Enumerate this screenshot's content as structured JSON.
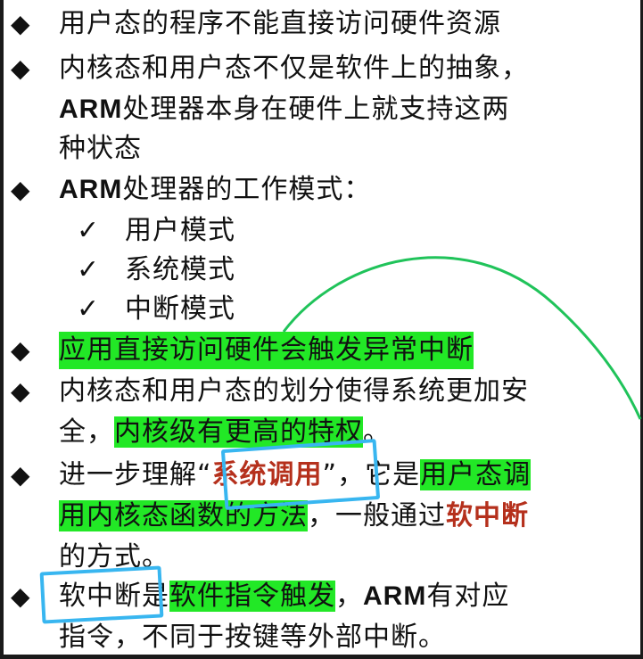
{
  "slide": {
    "bullet_symbol": "◆",
    "check_symbol": "✓",
    "lines": {
      "l1": "用户态的程序不能直接访问硬件资源",
      "l2": "内核态和用户态不仅是软件上的抽象，",
      "l3a": "ARM",
      "l3b": "处理器本身在硬件上就支持这两",
      "l4": "种状态",
      "l5a": "ARM",
      "l5b": "处理器的工作模式：",
      "m1": "用户模式",
      "m2": "系统模式",
      "m3": "中断模式",
      "l6": "应用直接访问硬件会触发异常中断",
      "l7": "内核态和用户态的划分使得系统更加安",
      "l8a": "全，",
      "l8b": "内核级有更高的特权",
      "l8c": "。",
      "l9a": "进一步理解“",
      "l9b": "系统调用",
      "l9c": "”，它是",
      "l9d": "用户态调",
      "l10a": "用内核态函数的方法",
      "l10b": "，一般通过",
      "l10c": "软中断",
      "l11": "的方式。",
      "l12a": "软中断",
      "l12b": "是",
      "l12c": "软件指令触发",
      "l12d": "，",
      "l12e": "ARM",
      "l12f": "有对应",
      "l13": "指令，不同于按键等外部中断。"
    }
  },
  "colors": {
    "highlight": "#22e826",
    "red_text": "#b5301c",
    "annotation_blue": "#38b6f0",
    "annotation_green": "#20c35a"
  }
}
